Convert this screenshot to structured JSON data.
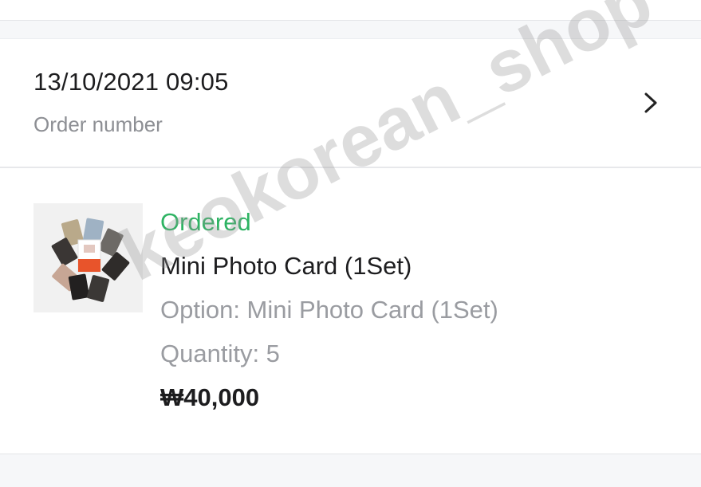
{
  "order": {
    "datetime": "13/10/2021 09:05",
    "number_label": "Order number"
  },
  "item": {
    "status": "Ordered",
    "status_color": "#2eb363",
    "name": "Mini Photo Card (1Set)",
    "option": "Option: Mini Photo Card (1Set)",
    "quantity": "Quantity: 5",
    "price": "₩40,000"
  },
  "watermark": "keokorean_shop",
  "icons": {
    "chevron": "chevron-right-icon"
  }
}
